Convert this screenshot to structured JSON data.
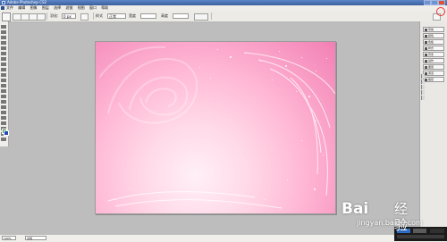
{
  "window": {
    "title": "Adobe Photoshop CS2",
    "brand_color": "#3c5f9d"
  },
  "menu": {
    "items": [
      "文件",
      "编辑",
      "图像",
      "图层",
      "选择",
      "滤镜",
      "视图",
      "窗口",
      "帮助"
    ]
  },
  "options_bar": {
    "label_style": "样式",
    "style_value": "正常",
    "label_width": "宽度",
    "label_height": "高度"
  },
  "canvas": {
    "colors": [
      "#fff0f6",
      "#ffd8e7",
      "#ffb8d5",
      "#f27fb4"
    ]
  },
  "panels": {
    "buttons": [
      "导航",
      "颜色",
      "色板",
      "样式",
      "历史",
      "动作",
      "图层",
      "通道",
      "路径"
    ]
  },
  "statusbar": {
    "zoom": "100%",
    "doc": "文档"
  },
  "watermark": {
    "brand": "Bai",
    "brand_suffix": "经验",
    "url": "jingyan.baidu.com"
  }
}
